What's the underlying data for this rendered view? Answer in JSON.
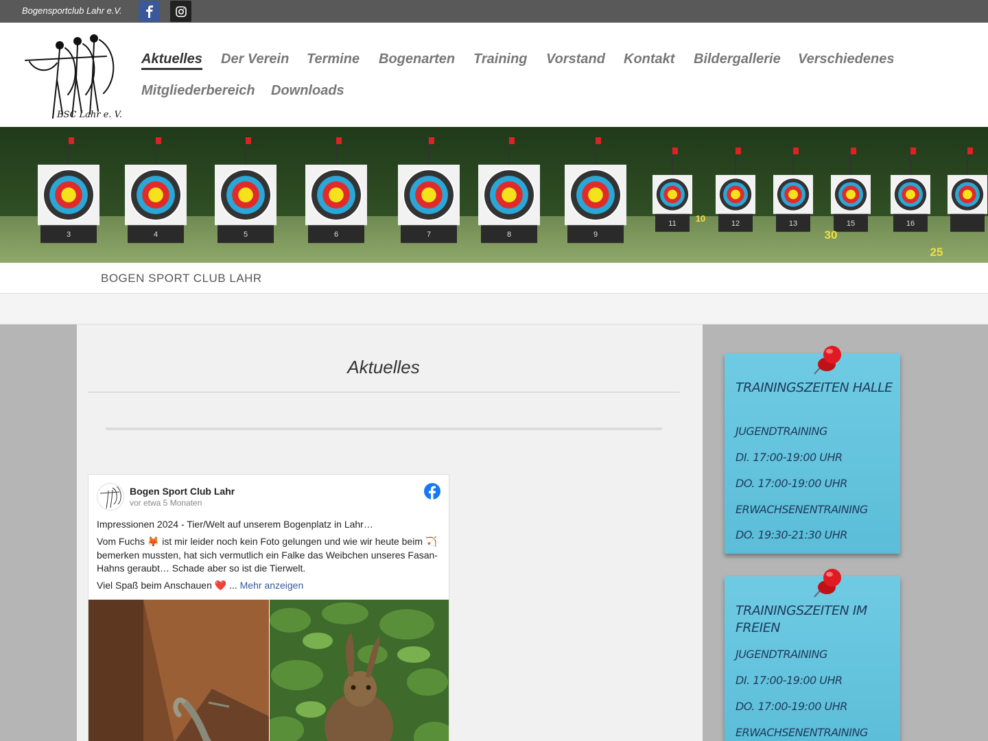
{
  "topbar": {
    "club_name": "Bogensportclub Lahr e.V."
  },
  "logo": {
    "caption": "BSC Lahr e. V."
  },
  "nav": {
    "items": [
      {
        "label": "Aktuelles",
        "active": true
      },
      {
        "label": "Der Verein"
      },
      {
        "label": "Termine"
      },
      {
        "label": "Bogenarten"
      },
      {
        "label": "Training"
      },
      {
        "label": "Vorstand"
      },
      {
        "label": "Kontakt"
      },
      {
        "label": "Bildergallerie"
      },
      {
        "label": "Verschiedenes"
      },
      {
        "label": "Mitgliederbereich"
      },
      {
        "label": "Downloads"
      }
    ]
  },
  "banner": {
    "target_numbers": [
      "3",
      "4",
      "5",
      "6",
      "7",
      "8",
      "9",
      "11",
      "12",
      "13",
      "15",
      "16"
    ],
    "distance_markers": [
      "10",
      "30",
      "25"
    ]
  },
  "site_title": "BOGEN SPORT CLUB LAHR",
  "main": {
    "title": "Aktuelles",
    "post": {
      "page_name": "Bogen Sport Club Lahr",
      "time": "vor etwa 5 Monaten",
      "line1": "Impressionen 2024 - Tier/Welt auf unserem Bogenplatz in Lahr…",
      "line2": "Vom Fuchs 🦊 ist mir leider noch kein Foto gelungen und wie wir heute beim 🏹 bemerken mussten, hat sich vermutlich ein Falke das Weibchen unseres Fasan-Hahns geraubt… Schade aber so ist die Tierwelt.",
      "line3": "Viel Spaß beim Anschauen ❤️ ...",
      "more": "Mehr anzeigen"
    }
  },
  "sidebar": {
    "notes": [
      {
        "heading": "Trainingszeiten Halle",
        "lines": [
          "Jugendtraining",
          "Di. 17:00-19:00 Uhr",
          "Do. 17:00-19:00 Uhr",
          "Erwachsenentraining",
          "Do. 19:30-21:30 Uhr"
        ]
      },
      {
        "heading": "Trainingszeiten im Freien",
        "lines": [
          "Jugendtraining",
          "Di. 17:00-19:00 Uhr",
          "Do. 17:00-19:00 Uhr",
          "Erwachsenentraining"
        ]
      }
    ]
  },
  "colors": {
    "topbar": "#595959",
    "facebook": "#3b5998",
    "note": "#6fcbe3",
    "note_text": "#1e3a5c",
    "pin": "#d4141c"
  }
}
